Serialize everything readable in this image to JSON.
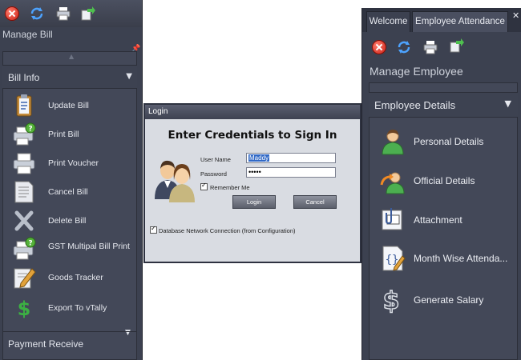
{
  "left_panel": {
    "title": "Manage Bill",
    "sections": {
      "bill_info": "Bill Info",
      "payment_receive": "Payment Receive"
    },
    "items": [
      {
        "label": "Update Bill",
        "icon": "clipboard-icon"
      },
      {
        "label": "Print Bill",
        "icon": "printer-help-icon"
      },
      {
        "label": "Print Voucher",
        "icon": "printer-icon"
      },
      {
        "label": "Cancel Bill",
        "icon": "document-icon"
      },
      {
        "label": "Delete Bill",
        "icon": "delete-x-icon"
      },
      {
        "label": "GST Multipal Bill Print",
        "icon": "printer-help-icon"
      },
      {
        "label": "Goods Tracker",
        "icon": "pencil-note-icon"
      },
      {
        "label": "Export To vTally",
        "icon": "dollar-icon"
      }
    ]
  },
  "login": {
    "window_title": "Login",
    "heading": "Enter Credentials to Sign In",
    "user_name_label": "User Name",
    "user_name_value": "Maddy",
    "password_label": "Password",
    "password_value": "•••••",
    "remember_me": "Remember Me",
    "login_button": "Login",
    "cancel_button": "Cancel",
    "db_connection": "Database  Network Connection (from Configuration)"
  },
  "right_panel": {
    "tabs": [
      "Welcome",
      "Employee Attendance"
    ],
    "close_tab": "✕",
    "title": "Manage Employee",
    "section": "Employee Details",
    "items": [
      {
        "label": "Personal Details",
        "icon": "person-icon"
      },
      {
        "label": "Official Details",
        "icon": "person-switch-icon"
      },
      {
        "label": "Attachment",
        "icon": "attachment-icon"
      },
      {
        "label": "Month Wise Attenda...",
        "icon": "calendar-bracket-icon"
      },
      {
        "label": "Generate Salary",
        "icon": "dollar-outline-icon"
      }
    ]
  },
  "colors": {
    "panel_bg": "#3c4150",
    "dialog_bg": "#d9dce2",
    "selection": "#3169c6"
  }
}
